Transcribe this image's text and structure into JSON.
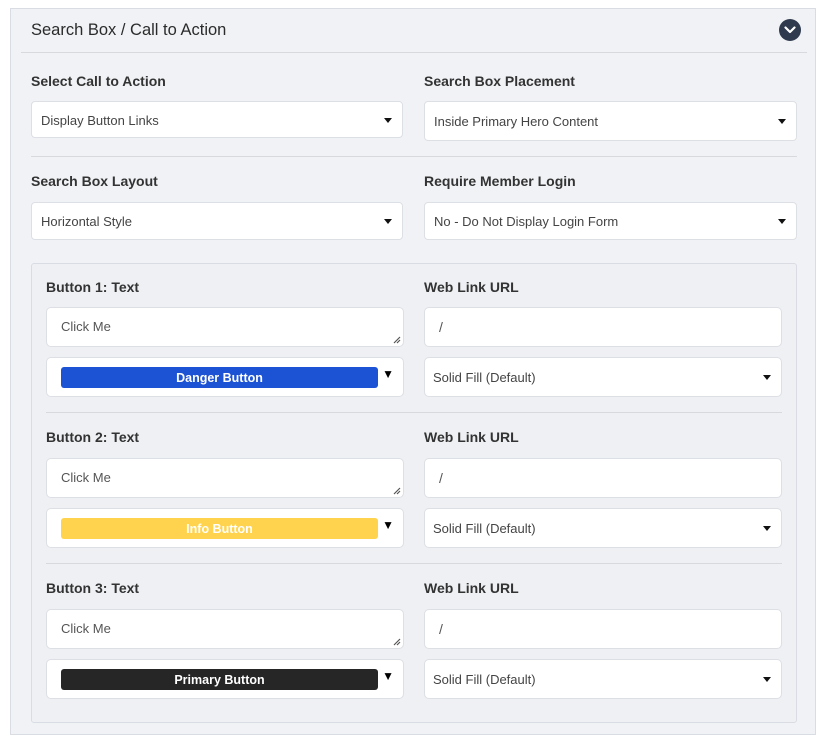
{
  "panel": {
    "title": "Search Box / Call to Action",
    "collapse_icon": "chevron-down-icon"
  },
  "fields": {
    "call_to_action": {
      "label": "Select Call to Action",
      "value": "Display Button Links"
    },
    "placement": {
      "label": "Search Box Placement",
      "value": "Inside Primary Hero Content"
    },
    "layout": {
      "label": "Search Box Layout",
      "value": "Horizontal Style"
    },
    "member_login": {
      "label": "Require Member Login",
      "value": "No - Do Not Display Login Form"
    }
  },
  "buttons": [
    {
      "text_label": "Button 1: Text",
      "text_placeholder": "Click Me",
      "url_label": "Web Link URL",
      "url_value": "/",
      "style": "Danger Button",
      "style_color": "#1c52d4",
      "style_text_color": "#ffffff",
      "fill": "Solid Fill (Default)"
    },
    {
      "text_label": "Button 2: Text",
      "text_placeholder": "Click Me",
      "url_label": "Web Link URL",
      "url_value": "/",
      "style": "Info Button",
      "style_color": "#ffd34d",
      "style_text_color": "#ffffff",
      "fill": "Solid Fill (Default)"
    },
    {
      "text_label": "Button 3: Text",
      "text_placeholder": "Click Me",
      "url_label": "Web Link URL",
      "url_value": "/",
      "style": "Primary Button",
      "style_color": "#262626",
      "style_text_color": "#ffffff",
      "fill": "Solid Fill (Default)"
    }
  ]
}
